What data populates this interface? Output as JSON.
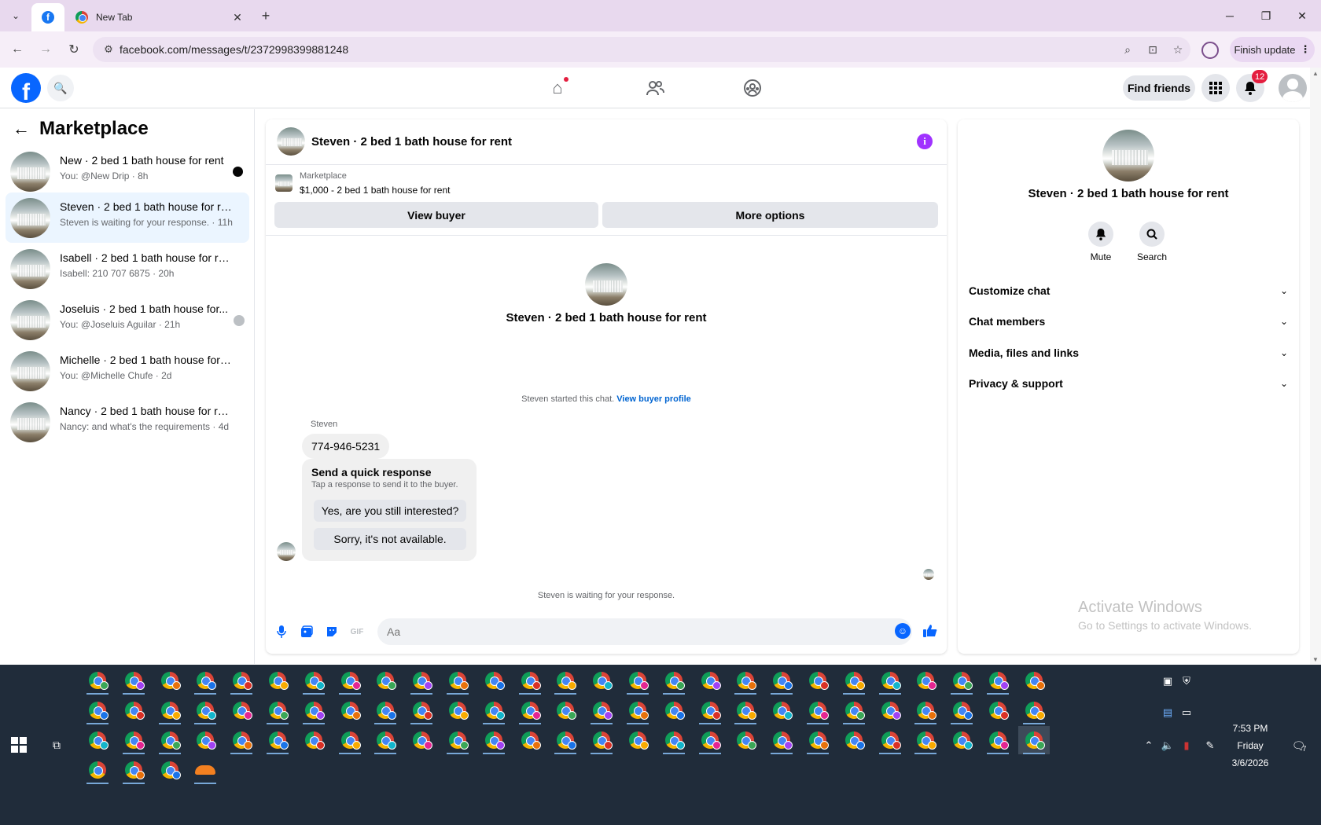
{
  "browser": {
    "tabs": [
      {
        "title": "",
        "favicon": "facebook-icon",
        "active": true
      },
      {
        "title": "New Tab",
        "favicon": "chrome-icon",
        "active": false
      }
    ],
    "url": "facebook.com/messages/t/2372998399881248",
    "finish_update_label": "Finish update"
  },
  "fb_header": {
    "find_friends_label": "Find friends",
    "notification_count": "12"
  },
  "sidebar": {
    "title": "Marketplace",
    "conversations": [
      {
        "name": "New · 2 bed 1 bath house for rent",
        "subtitle": "You: @New Drip · 8h",
        "unread": true
      },
      {
        "name": "Steven · 2 bed 1 bath house for rent",
        "subtitle": "Steven is waiting for your response. · 11h",
        "selected": true
      },
      {
        "name": "Isabell · 2 bed 1 bath house for rent",
        "subtitle": "Isabell: 210 707 6875 · 20h"
      },
      {
        "name": "Joseluis · 2 bed 1 bath house for...",
        "subtitle": "You: @Joseluis Aguilar · 21h",
        "seen": true
      },
      {
        "name": "Michelle · 2 bed 1 bath house for r...",
        "subtitle": "You: @Michelle Chufe · 2d"
      },
      {
        "name": "Nancy · 2 bed 1 bath house for rent",
        "subtitle": "Nancy: and what's the requirements · 4d"
      }
    ]
  },
  "chat": {
    "title": "Steven · 2 bed 1 bath house for rent",
    "listing_category": "Marketplace",
    "listing_price_title": "$1,000 - 2 bed 1 bath house for rent",
    "view_buyer_label": "View buyer",
    "more_options_label": "More options",
    "intro_name": "Steven · 2 bed 1 bath house for rent",
    "started_text": "Steven started this chat.",
    "view_buyer_profile_label": "View buyer profile",
    "sender_name": "Steven",
    "phone_message": "774-946-5231",
    "quick_response_title": "Send a quick response",
    "quick_response_subtitle": "Tap a response to send it to the buyer.",
    "quick_responses": [
      "Yes, are you still interested?",
      "Sorry, it's not available."
    ],
    "waiting_text": "Steven is waiting for your response.",
    "composer_placeholder": "Aa"
  },
  "info_panel": {
    "name": "Steven · 2 bed 1 bath house for rent",
    "actions": [
      {
        "label": "Mute",
        "icon": "bell-icon"
      },
      {
        "label": "Search",
        "icon": "search-icon"
      }
    ],
    "sections": [
      "Customize chat",
      "Chat members",
      "Media, files and links",
      "Privacy & support"
    ]
  },
  "watermark": {
    "line1": "Activate Windows",
    "line2": "Go to Settings to activate Windows."
  },
  "taskbar": {
    "time": "7:53 PM",
    "day": "Friday",
    "date": "3/6/2026",
    "notification_count": "7"
  },
  "colors": {
    "fb_blue": "#0866ff",
    "messenger_purple": "#a033ff",
    "selected_row": "#ebf5ff",
    "notification_red": "#e41e3f",
    "taskbar_bg": "#202c3a"
  }
}
